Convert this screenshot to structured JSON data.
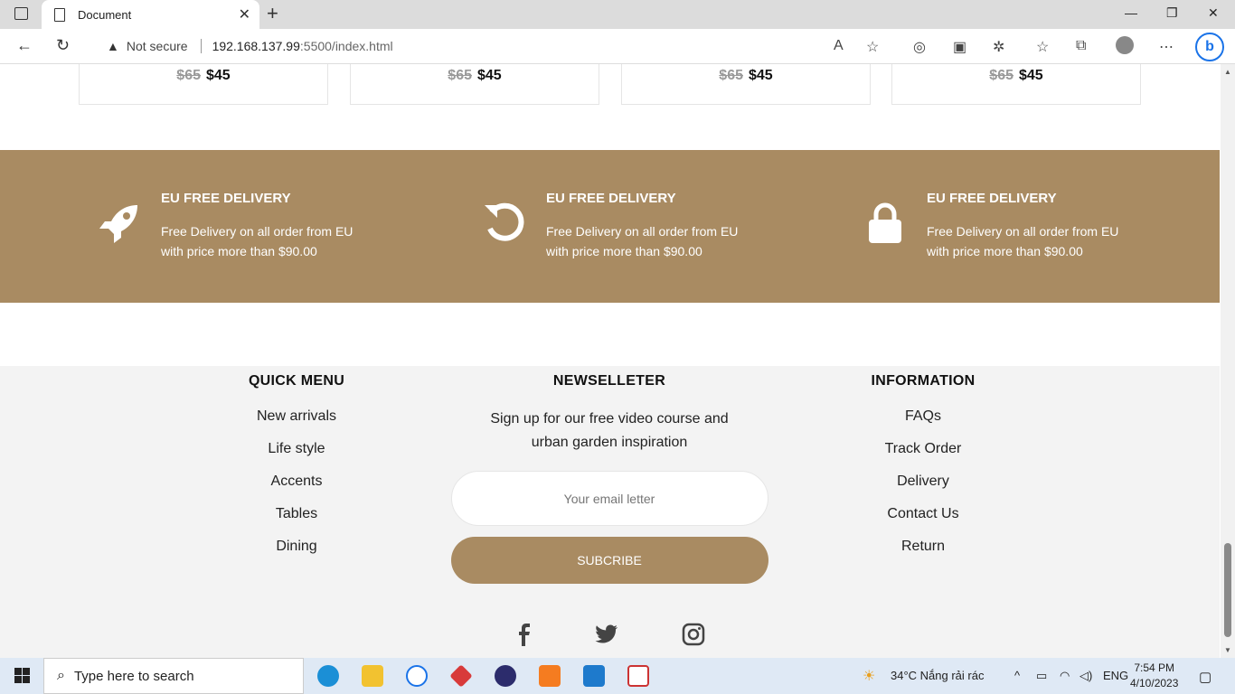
{
  "browser": {
    "tab_title": "Document",
    "security_label": "Not secure",
    "url_host": "192.168.137.99",
    "url_path": ":5500/index.html"
  },
  "products": [
    {
      "old_price": "$65",
      "price": "$45"
    },
    {
      "old_price": "$65",
      "price": "$45"
    },
    {
      "old_price": "$65",
      "price": "$45"
    },
    {
      "old_price": "$65",
      "price": "$45"
    }
  ],
  "features": [
    {
      "icon": "rocket-icon",
      "title": "EU FREE DELIVERY",
      "desc": "Free Delivery on all order from EU with price more than $90.00"
    },
    {
      "icon": "refresh-icon",
      "title": "EU FREE DELIVERY",
      "desc": "Free Delivery on all order from EU with price more than $90.00"
    },
    {
      "icon": "lock-icon",
      "title": "EU FREE DELIVERY",
      "desc": "Free Delivery on all order from EU with price more than $90.00"
    }
  ],
  "footer": {
    "quick_menu": {
      "title": "QUICK MENU",
      "links": [
        "New arrivals",
        "Life style",
        "Accents",
        "Tables",
        "Dining"
      ]
    },
    "newsletter": {
      "title": "NEWSELLETER",
      "text": "Sign up for our free video course and urban garden inspiration",
      "email_placeholder": "Your email letter",
      "button": "SUBCRIBE"
    },
    "information": {
      "title": "INFORMATION",
      "links": [
        "FAQs",
        "Track Order",
        "Delivery",
        "Contact Us",
        "Return"
      ]
    },
    "social": [
      "facebook-icon",
      "twitter-icon",
      "instagram-icon"
    ]
  },
  "taskbar": {
    "search_placeholder": "Type here to search",
    "weather": "34°C  Nắng rải rác",
    "language": "ENG",
    "time": "7:54 PM",
    "date": "4/10/2023"
  },
  "colors": {
    "accent": "#a98b62",
    "footer_bg": "#f3f3f3"
  }
}
